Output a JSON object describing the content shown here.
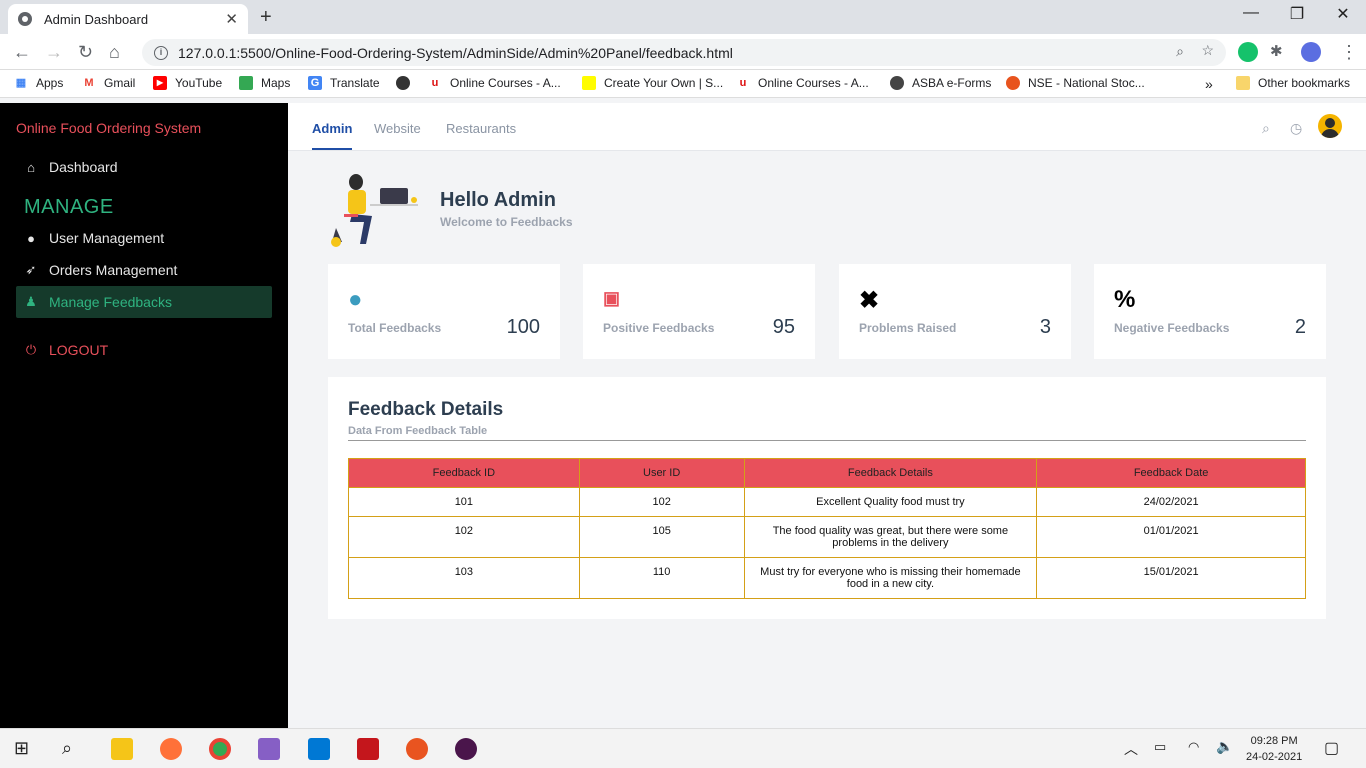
{
  "browser": {
    "tab_title": "Admin Dashboard",
    "url": "127.0.0.1:5500/Online-Food-Ordering-System/AdminSide/Admin%20Panel/feedback.html",
    "bookmarks": [
      "Apps",
      "Gmail",
      "YouTube",
      "Maps",
      "Translate",
      "Online Courses - A...",
      "Create Your Own | S...",
      "Online Courses - A...",
      "ASBA e-Forms",
      "NSE - National Stoc..."
    ],
    "more_bookmarks": "»",
    "other_bookmarks": "Other bookmarks"
  },
  "sidebar": {
    "brand": "Online Food Ordering System",
    "dashboard": "Dashboard",
    "section": "MANAGE",
    "items": [
      "User Management",
      "Orders Management",
      "Manage Feedbacks"
    ],
    "logout": "LOGOUT"
  },
  "topnav": {
    "tabs": [
      "Admin",
      "Website",
      "Restaurants"
    ]
  },
  "greeting": {
    "title": "Hello Admin",
    "subtitle": "Welcome to Feedbacks"
  },
  "cards": [
    {
      "label": "Total Feedbacks",
      "value": "100",
      "icon": "bomb-icon",
      "color": "#3b9cbf"
    },
    {
      "label": "Positive Feedbacks",
      "value": "95",
      "icon": "money-icon",
      "color": "#e8505b"
    },
    {
      "label": "Problems Raised",
      "value": "3",
      "icon": "x-icon",
      "color": "#000000"
    },
    {
      "label": "Negative Feedbacks",
      "value": "2",
      "icon": "percent-icon",
      "color": "#000000"
    }
  ],
  "panel": {
    "title": "Feedback Details",
    "subtitle": "Data From Feedback Table",
    "headers": [
      "Feedback ID",
      "User ID",
      "Feedback Details",
      "Feedback Date"
    ],
    "rows": [
      [
        "101",
        "102",
        "Excellent Quality food must try",
        "24/02/2021"
      ],
      [
        "102",
        "105",
        "The food quality was great, but there were some problems in the delivery",
        "01/01/2021"
      ],
      [
        "103",
        "110",
        "Must try for everyone who is missing their homemade food in a new city.",
        "15/01/2021"
      ]
    ]
  },
  "taskbar": {
    "time": "09:28 PM",
    "date": "24-02-2021"
  },
  "colors": {
    "accent": "#e8505b",
    "green": "#2fb380",
    "blue": "#1f4ea6"
  }
}
